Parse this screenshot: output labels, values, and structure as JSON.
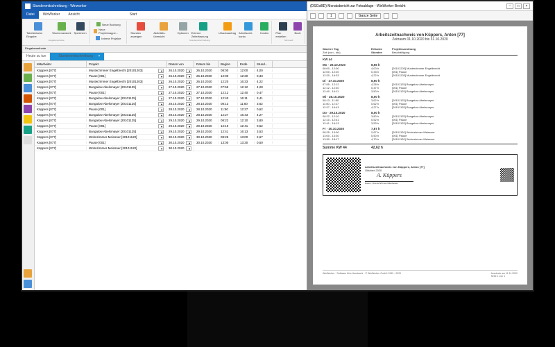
{
  "main": {
    "title": "Stundenmitschreibung - Winworker",
    "menu": {
      "datei": "Datei",
      "winworker": "WinWorker",
      "ansicht": "Ansicht",
      "start": "Start"
    },
    "ribbon": {
      "tabellarische": "Tabellarische Eingabe",
      "wochenansicht": "Wochenansicht",
      "speichern": "Speichern",
      "neue_buchung": "Neue Buchung",
      "neue_projektmappe": "Neue Projektmappe...",
      "interne_projekte": "Interne Projekte",
      "stunden_anzeigen": "Stunden anzeigen",
      "aktivitaets": "Aktivitäts-übersicht",
      "optionen": "Optionen",
      "externe": "Externe Zeiterfassung",
      "urlaubsantrag": "Urlaubsantrag",
      "arbeitszeit": "Arbeitszeit-konto",
      "kosten": "Kosten",
      "plan": "Plan erstellen",
      "buch": "Buch",
      "group1": "Eingabemethode",
      "group2": "",
      "group3": "Stundenmitschreibung",
      "group4": "Microsoft"
    },
    "subbar": "Eingabemethode",
    "doctabs": {
      "tab1": "Heute zu tun",
      "tab2": "Stundenmitschreibung"
    },
    "grid": {
      "cols": {
        "mitarbeiter": "Mitarbeiter",
        "projekt": "Projekt",
        "datum_von": "Datum von",
        "datum_bis": "Datum bis",
        "beginn": "Beginn",
        "ende": "Ende",
        "stund": "Stund..."
      },
      "rows": [
        {
          "m": "Küppers [077] <Anton>",
          "p": "Musterzimmer Engelbrecht [20101203]",
          "dv": "26.10.2020",
          "db": "26.10.2020",
          "b": "08:00",
          "e": "12:00",
          "s": "4,00"
        },
        {
          "m": "Küppers [077] <Anton>",
          "p": "Pause [001]",
          "dv": "26.10.2020",
          "db": "26.10.2020",
          "b": "12:00",
          "e": "12:20",
          "s": "0,33"
        },
        {
          "m": "Küppers [077] <Anton>",
          "p": "Musterzimmer Engelbrecht [20101203]",
          "dv": "26.10.2020",
          "db": "26.10.2020",
          "b": "12:20",
          "e": "16:33",
          "s": "4,22"
        },
        {
          "m": "Küppers [077] <Anton>",
          "p": "Bungalow Abelsmayer [20101125]",
          "dv": "27.10.2020",
          "db": "27.10.2020",
          "b": "07:55",
          "e": "12:12",
          "s": "4,28"
        },
        {
          "m": "Küppers [077] <Anton>",
          "p": "Pause [001]",
          "dv": "27.10.2020",
          "db": "27.10.2020",
          "b": "12:12",
          "e": "12:40",
          "s": "0,47"
        },
        {
          "m": "Küppers [077] <Anton>",
          "p": "Bungalow Abelsmayer [20101125]",
          "dv": "27.10.2020",
          "db": "27.10.2020",
          "b": "12:40",
          "e": "16:11",
          "s": "3,41"
        },
        {
          "m": "Küppers [077] <Anton>",
          "p": "Bungalow Abelsmayer [20101125]",
          "dv": "28.10.2020",
          "db": "28.10.2020",
          "b": "08:13",
          "e": "11:50",
          "s": "3,62"
        },
        {
          "m": "Küppers [077] <Anton>",
          "p": "Pause [001]",
          "dv": "28.10.2020",
          "db": "28.10.2020",
          "b": "11:50",
          "e": "12:27",
          "s": "0,62"
        },
        {
          "m": "Küppers [077] <Anton>",
          "p": "Bungalow Abelsmayer [20101125]",
          "dv": "28.10.2020",
          "db": "28.10.2020",
          "b": "12:27",
          "e": "16:43",
          "s": "4,27"
        },
        {
          "m": "Küppers [077] <Anton>",
          "p": "Bungalow Abelsmayer [20101125]",
          "dv": "29.10.2020",
          "db": "29.10.2020",
          "b": "08:22",
          "e": "12:10",
          "s": "3,80"
        },
        {
          "m": "Küppers [077] <Anton>",
          "p": "Pause [001]",
          "dv": "29.10.2020",
          "db": "29.10.2020",
          "b": "12:10",
          "e": "12:41",
          "s": "0,52"
        },
        {
          "m": "Küppers [077] <Anton>",
          "p": "Bungalow Abelsmayer [20101125]",
          "dv": "29.10.2020",
          "db": "29.10.2020",
          "b": "12:41",
          "e": "16:13",
          "s": "3,53"
        },
        {
          "m": "Küppers [077] <Anton>",
          "p": "Wohnzimmer Meissner [20101120]",
          "dv": "30.10.2020",
          "db": "30.10.2020",
          "b": "08:25",
          "e": "13:00",
          "s": "2,67"
        },
        {
          "m": "Küppers [077] <Anton>",
          "p": "Pause [001]",
          "dv": "30.10.2020",
          "db": "30.10.2020",
          "b": "13:00",
          "e": "13:30",
          "s": "0,50"
        },
        {
          "m": "Küppers [077] <Anton>",
          "p": "Wohnzimmer Meissner [20101120]",
          "dv": "30.10.2020",
          "db": "",
          "b": "",
          "e": "",
          "s": ""
        }
      ]
    }
  },
  "report": {
    "title": "(DSGoBD) Monatsbericht zur Fotoablage - WinWorker Bericht",
    "toolbar": {
      "ganze_seite": "Ganze Seite",
      "page": "1"
    },
    "page": {
      "h1": "Arbeitszeitnachweis von Küppers, Anton [77]",
      "h2": "Zeitraum 01.10.2020 bis 31.10.2020",
      "col1": "Woche / Tag",
      "col1b": "Zeit (von - bis)",
      "col2": "Erfasste Stunden",
      "col3": "Projektzuordnung",
      "col3b": "Beschäftigung",
      "kw": "KW 44",
      "days": [
        {
          "d": "Mo · 26.10.2020",
          "t": "8,56 h",
          "rows": [
            {
              "z": "08:00 - 12:00",
              "h": "4,00 h",
              "p": "[20101203] Musterzimmer Engelbrecht"
            },
            {
              "z": "12:00 - 12:20",
              "h": "0,33 h",
              "p": "[001] Pause"
            },
            {
              "z": "12:20 - 16:33",
              "h": "4,22 h",
              "p": "[20101203] Musterzimmer Engelbrecht"
            }
          ]
        },
        {
          "d": "Di · 27.10.2020",
          "t": "8,50 h",
          "rows": [
            {
              "z": "07:55 - 12:12",
              "h": "4,28 h",
              "p": "[20101125] Bungalow Abelsmayer"
            },
            {
              "z": "12:12 - 12:40",
              "h": "0,47 h",
              "p": "[001] Pause"
            },
            {
              "z": "12:40 - 16:11",
              "h": "3,50 h",
              "p": "[20101125] Bungalow Abelsmayer"
            }
          ]
        },
        {
          "d": "Mi · 28.10.2020",
          "t": "8,00 h",
          "rows": [
            {
              "z": "08:13 - 11:50",
              "h": "3,62 h",
              "p": "[20101125] Bungalow Abelsmayer"
            },
            {
              "z": "11:50 - 12:27",
              "h": "0,62 h",
              "p": "[001] Pause"
            },
            {
              "z": "12:27 - 16:43",
              "h": "4,27 h",
              "p": "[20101125] Bungalow Abelsmayer"
            }
          ]
        },
        {
          "d": "Do · 29.10.2020",
          "t": "8,00 h",
          "rows": [
            {
              "z": "08:22 - 12:10",
              "h": "3,80 h",
              "p": "[20101125] Bungalow Abelsmayer"
            },
            {
              "z": "12:10 - 12:41",
              "h": "0,52 h",
              "p": "[001] Pause"
            },
            {
              "z": "12:41 - 16:13",
              "h": "3,53 h",
              "p": "[20101125] Bungalow Abelsmayer"
            }
          ]
        },
        {
          "d": "Fr · 30.10.2020",
          "t": "7,87 h",
          "rows": [
            {
              "z": "08:25 - 13:00",
              "h": "2,67 h",
              "p": "[20101120] Wohnzimmer Meissner"
            },
            {
              "z": "13:00 - 13:30",
              "h": "0,50 h",
              "p": "[001] Pause"
            },
            {
              "z": "13:30 - 18:17",
              "h": "4,70 h",
              "p": "[20101120] Wohnzimmer Meissner"
            }
          ]
        }
      ],
      "sum_label": "Summe KW 44",
      "sum_val": "42,62 h",
      "sig_title": "Arbeitszeitnachweis von Küppers, Anton [77]",
      "sig_month": "Oktober 2020",
      "sig_name": "A. Küppers",
      "sig_sub": "Datum, Unterschrift des Mitarbeiters",
      "footer_l": "WinWorker · Software für's Handwerk · © WinWorker GmbH 1999 - 2020",
      "footer_r1": "Ausdruck am 11.11.2020",
      "footer_r2": "Seite 1 von 1"
    }
  }
}
